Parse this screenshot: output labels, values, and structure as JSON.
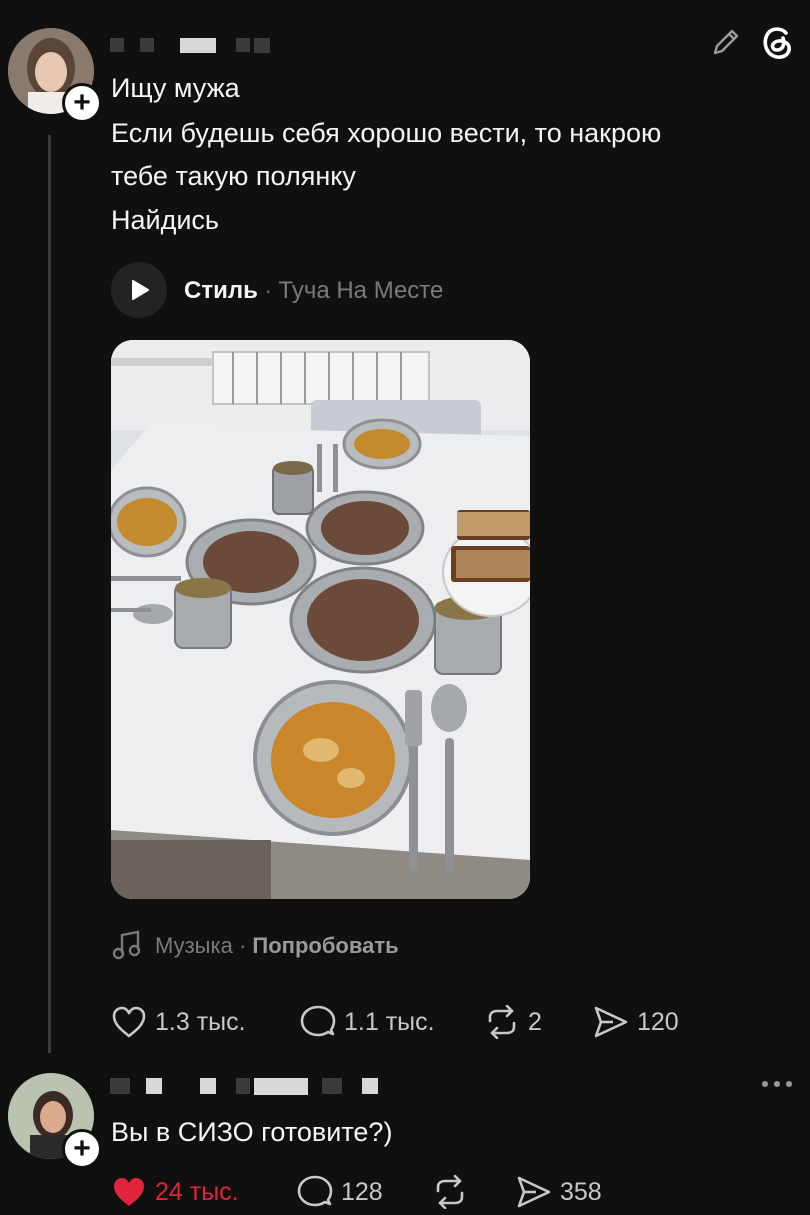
{
  "post": {
    "lines": [
      "Ищу мужа",
      "Если будешь себя хорошо вести, то накрою",
      "тебе такую полянку",
      "Найдись"
    ],
    "music": {
      "title": "Стиль",
      "separator": "·",
      "artist": "Туча На Месте"
    },
    "music_hint": {
      "label": "Музыка",
      "separator": "·",
      "action": "Попробовать"
    },
    "stats": {
      "likes": "1.3 тыс.",
      "comments": "1.1 тыс.",
      "reposts": "2",
      "shares": "120"
    }
  },
  "reply": {
    "text": "Вы в СИЗО готовите?)",
    "stats": {
      "likes": "24 тыс.",
      "comments": "128",
      "shares": "358"
    },
    "like_color": "#e0243b"
  },
  "icons": [
    "edit-icon",
    "threads-logo-icon",
    "play-icon",
    "music-note-icon",
    "heart-icon",
    "comment-icon",
    "repost-icon",
    "share-icon",
    "more-icon"
  ]
}
